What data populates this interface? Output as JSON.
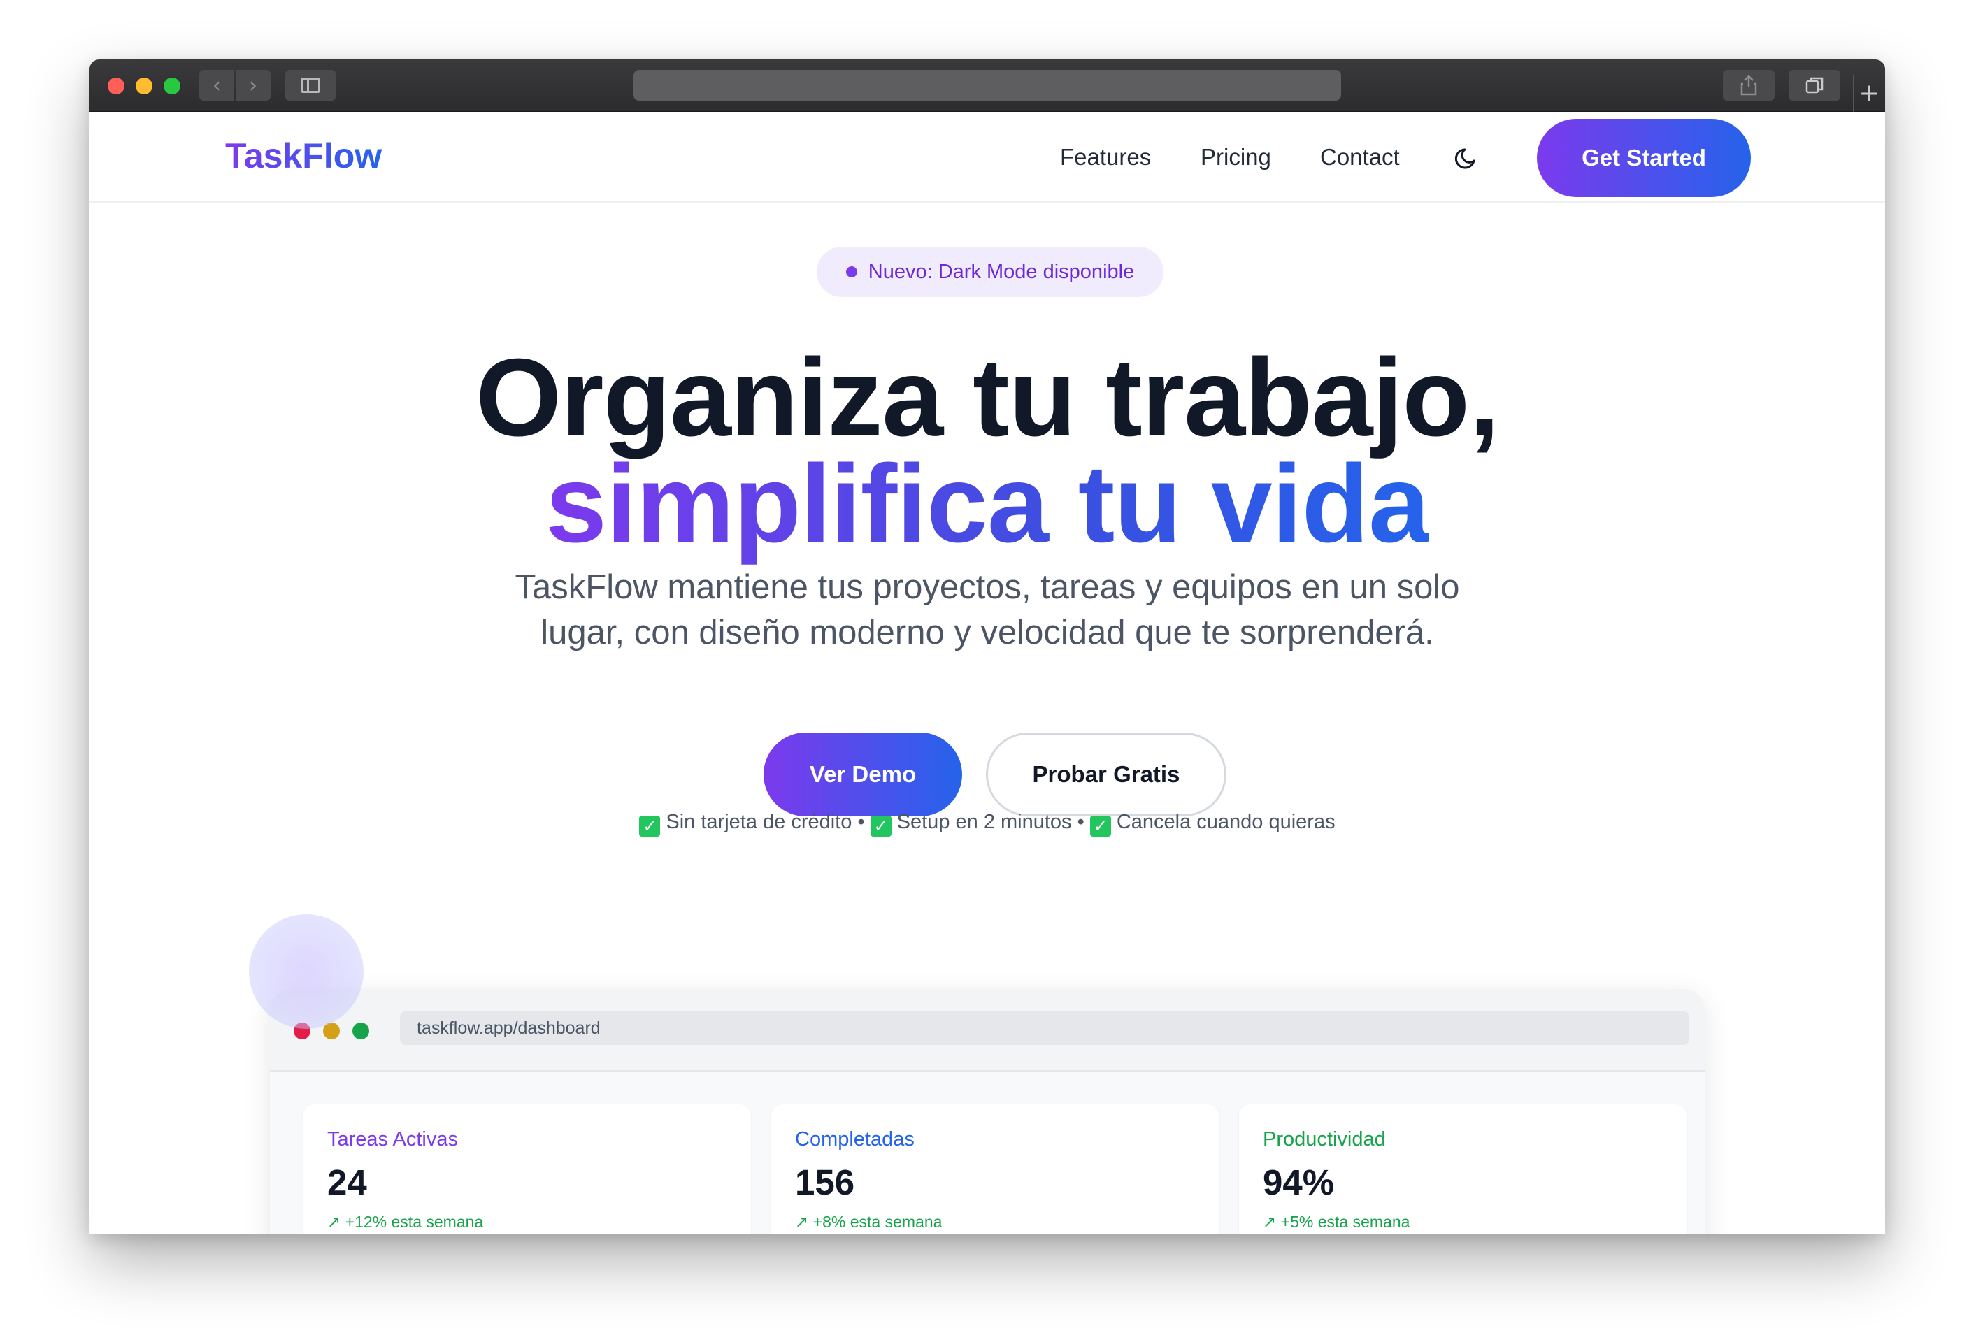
{
  "header": {
    "logo": "TaskFlow",
    "nav": [
      "Features",
      "Pricing",
      "Contact"
    ],
    "cta": "Get Started"
  },
  "badge": {
    "text": "Nuevo: Dark Mode disponible"
  },
  "hero": {
    "line1": "Organiza tu trabajo,",
    "line2": "simplifica tu vida",
    "subtitle": "TaskFlow mantiene tus proyectos, tareas y equipos en un solo lugar, con diseño moderno y velocidad que te sorprenderá."
  },
  "buttons": {
    "primary": "Ver Demo",
    "secondary": "Probar Gratis"
  },
  "perks": [
    "Sin tarjeta de crédito",
    "Setup en 2 minutos",
    "Cancela cuando quieras"
  ],
  "perk_separator": "•",
  "preview": {
    "url": "taskflow.app/dashboard",
    "stats": [
      {
        "label": "Tareas Activas",
        "value": "24",
        "trend": "↗ +12% esta semana"
      },
      {
        "label": "Completadas",
        "value": "156",
        "trend": "↗ +8% esta semana"
      },
      {
        "label": "Productividad",
        "value": "94%",
        "trend": "↗ +5% esta semana"
      }
    ]
  },
  "colors": {
    "brand_purple": "#7c3aed",
    "brand_blue": "#2563eb",
    "trend_green": "#16a34a"
  },
  "icons": [
    "moon-icon",
    "check-icon",
    "trend-up-icon"
  ]
}
